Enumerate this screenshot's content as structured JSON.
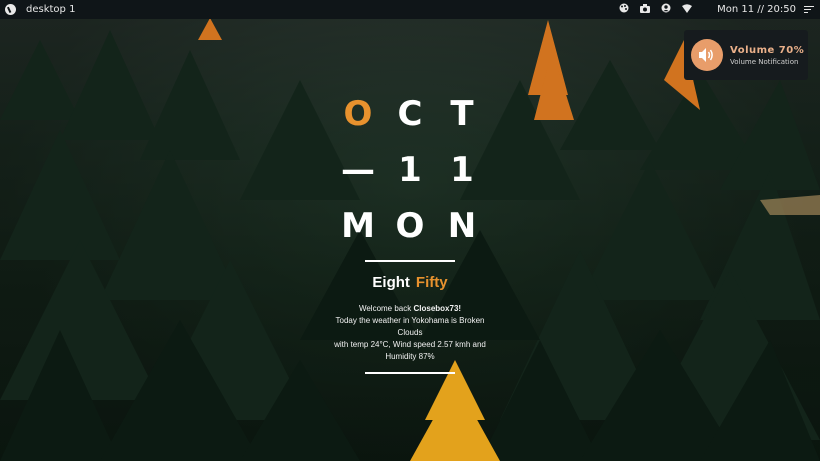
{
  "topbar": {
    "workspace": "desktop 1",
    "clock": "Mon 11 // 20:50",
    "icons": [
      "palette-icon",
      "camera-icon",
      "user-icon",
      "wifi-icon",
      "menu-icon"
    ]
  },
  "notification": {
    "title": "Volume 70%",
    "subtitle": "Volume Notification",
    "icon": "speaker-icon",
    "accent": "#e89d6a"
  },
  "widget": {
    "month": [
      "O",
      "C",
      "T"
    ],
    "day": [
      "—",
      "1",
      "1"
    ],
    "weekday": [
      "M",
      "O",
      "N"
    ],
    "time_word1": "Eight",
    "time_word2": "Fifty",
    "welcome_prefix": "Welcome back ",
    "username": "Closebox73!",
    "weather_line1": "Today the weather in Yokohama is Broken Clouds",
    "weather_line2": "with temp 24°C, Wind speed 2.57 kmh and Humidity 87%",
    "accent_color": "#e8922e"
  }
}
